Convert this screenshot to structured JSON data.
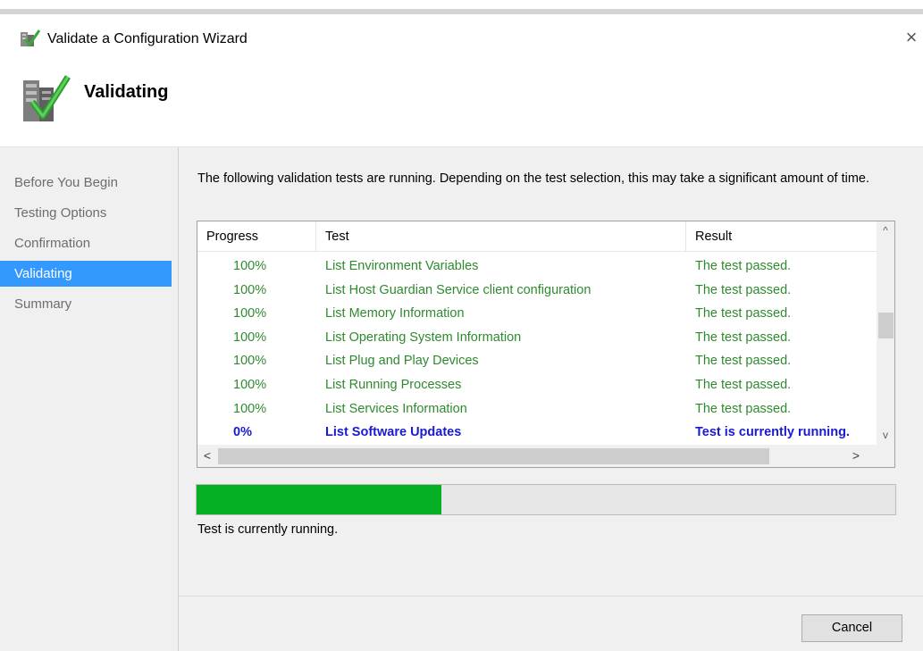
{
  "window": {
    "title": "Validate a Configuration Wizard",
    "close_glyph": "×"
  },
  "header": {
    "title": "Validating",
    "icon": "validation-wizard-icon"
  },
  "sidebar": {
    "items": [
      {
        "label": "Before You Begin",
        "active": false
      },
      {
        "label": "Testing Options",
        "active": false
      },
      {
        "label": "Confirmation",
        "active": false
      },
      {
        "label": "Validating",
        "active": true
      },
      {
        "label": "Summary",
        "active": false
      }
    ]
  },
  "main": {
    "description": "The following validation tests are running. Depending on the test selection, this may take a significant amount of time.",
    "columns": {
      "progress": "Progress",
      "test": "Test",
      "result": "Result"
    },
    "rows": [
      {
        "progress": "100%",
        "test": "List Environment Variables",
        "result": "The test passed."
      },
      {
        "progress": "100%",
        "test": "List Host Guardian Service client configuration",
        "result": "The test passed."
      },
      {
        "progress": "100%",
        "test": "List Memory Information",
        "result": "The test passed."
      },
      {
        "progress": "100%",
        "test": "List Operating System Information",
        "result": "The test passed."
      },
      {
        "progress": "100%",
        "test": "List Plug and Play Devices",
        "result": "The test passed."
      },
      {
        "progress": "100%",
        "test": "List Running Processes",
        "result": "The test passed."
      },
      {
        "progress": "100%",
        "test": "List Services Information",
        "result": "The test passed."
      },
      {
        "progress": "0%",
        "test": "List Software Updates",
        "result": "Test is currently running."
      }
    ],
    "scroll": {
      "up": "^",
      "down": "v",
      "left": "<",
      "right": ">"
    },
    "overall_progress": 0.35,
    "status": "Test is currently running."
  },
  "footer": {
    "cancel_label": "Cancel"
  },
  "colors": {
    "passed": "#2f8a2f",
    "running": "#1a1ad0",
    "progress_fill": "#06b025",
    "selection": "#3399ff"
  }
}
